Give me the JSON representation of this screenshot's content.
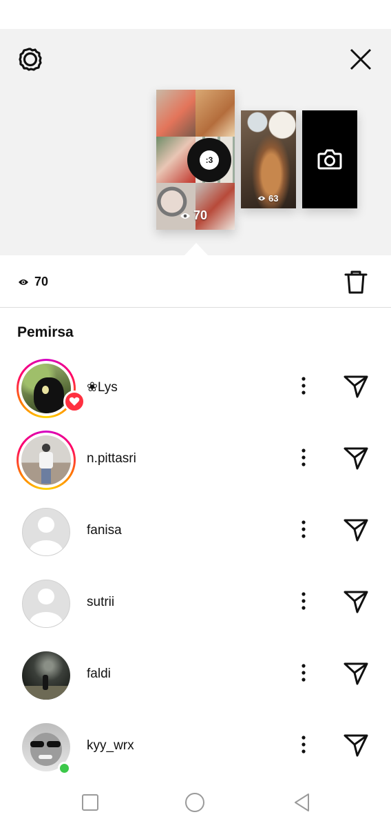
{
  "header": {
    "settings_icon": "gear-icon",
    "close_icon": "close-icon",
    "stories": [
      {
        "views": "70",
        "sticker_text": ":3"
      },
      {
        "views": "63"
      }
    ],
    "camera_icon": "camera-icon"
  },
  "views_bar": {
    "count": "70",
    "eye_icon": "eye-icon",
    "delete_icon": "trash-icon"
  },
  "viewers_section": {
    "title": "Pemirsa",
    "viewers": [
      {
        "username": "❀Lys",
        "ring": true,
        "badge": "heart"
      },
      {
        "username": "n.pittasri",
        "ring": true
      },
      {
        "username": "fanisa",
        "ring": false
      },
      {
        "username": "sutrii",
        "ring": false
      },
      {
        "username": "faldi",
        "ring": false
      },
      {
        "username": "kyy_wrx",
        "ring": false,
        "badge": "online"
      }
    ]
  },
  "nav": {
    "recent_icon": "square-icon",
    "home_icon": "circle-icon",
    "back_icon": "triangle-back-icon"
  },
  "colors": {
    "heart_badge": "#ff3040",
    "online": "#3cc84a",
    "header_bg": "#f2f2f2"
  }
}
